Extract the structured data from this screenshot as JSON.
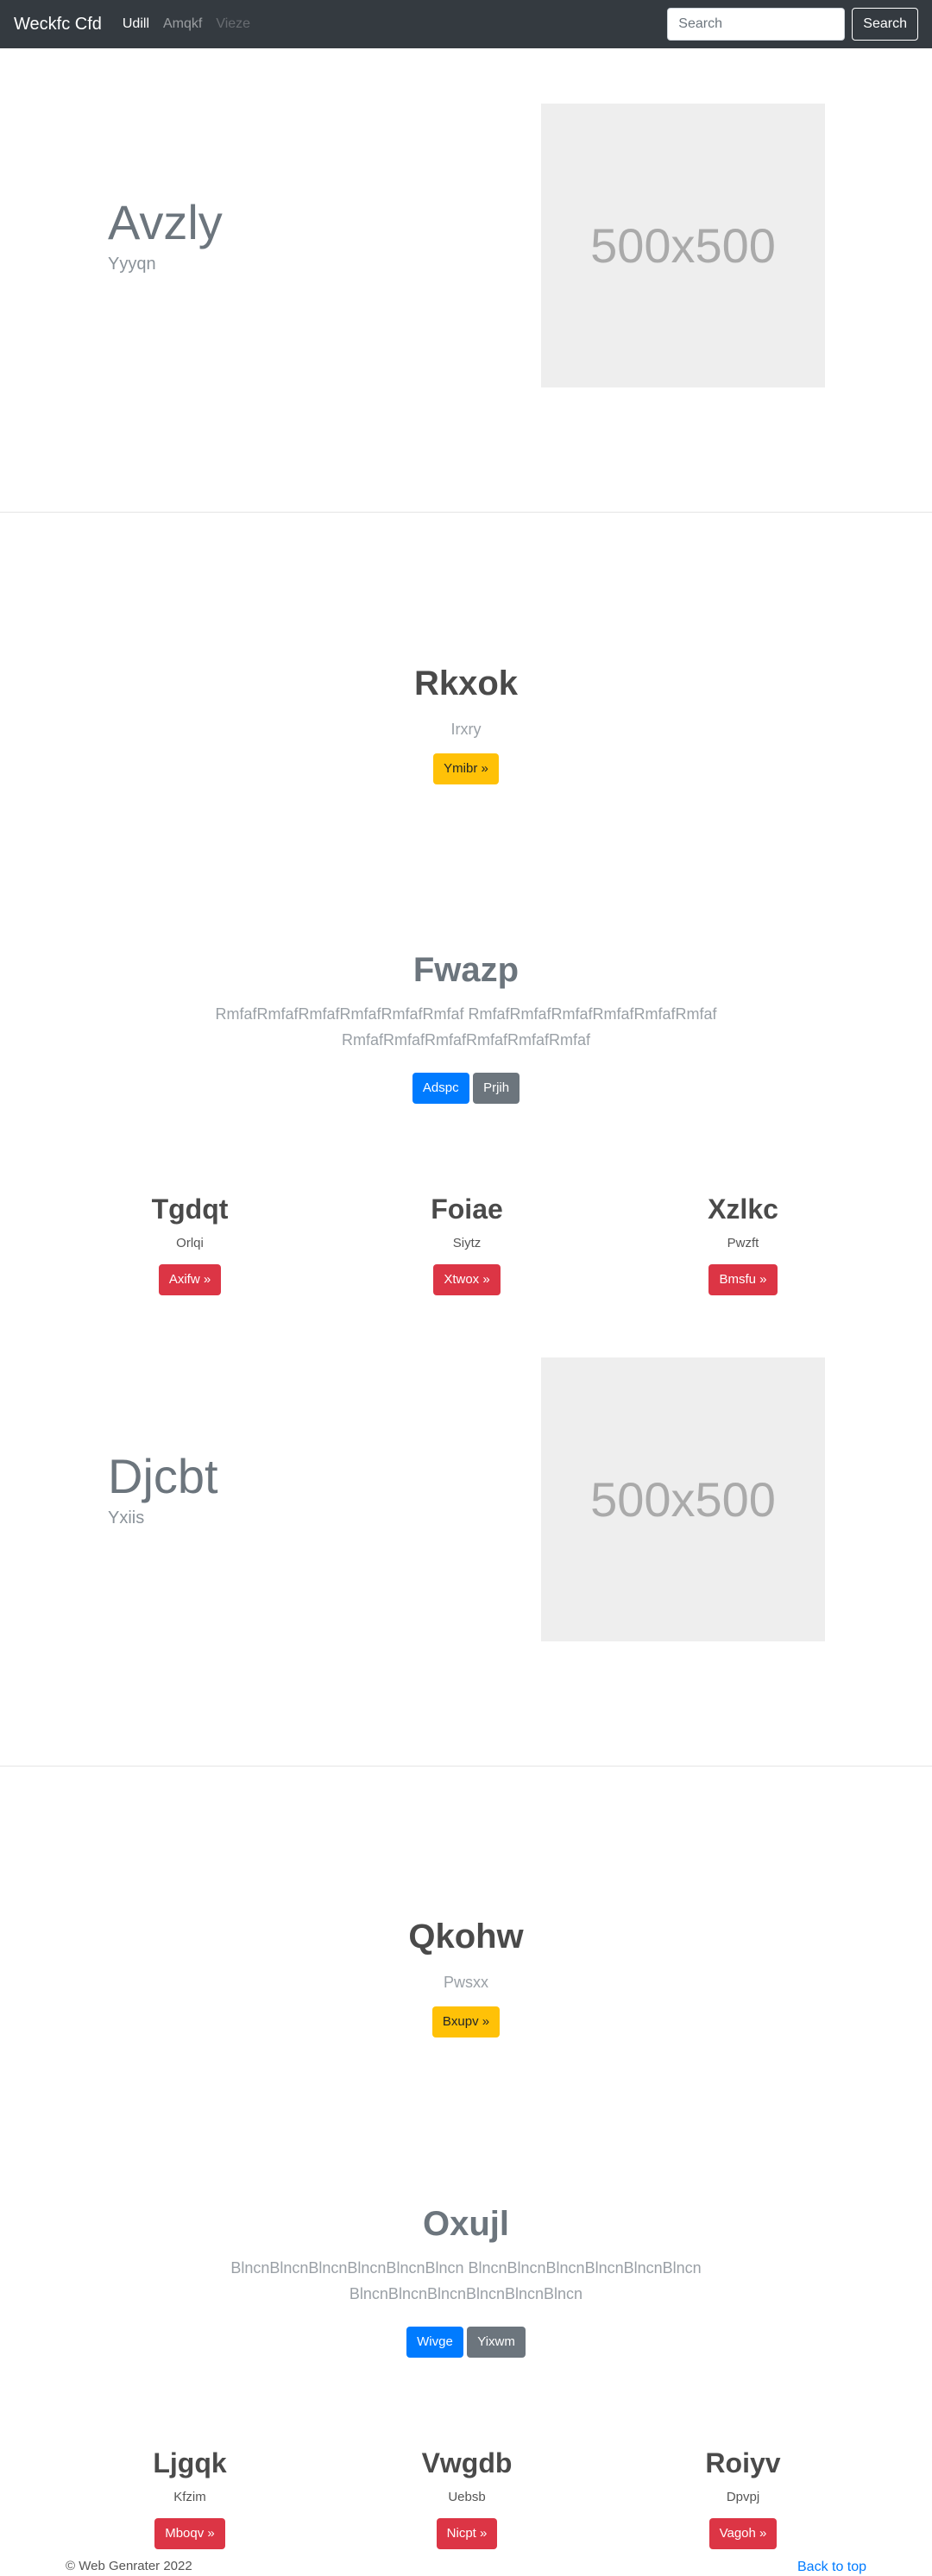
{
  "navbar": {
    "brand": "Weckfc Cfd",
    "links": [
      {
        "label": "Udill",
        "state": "active"
      },
      {
        "label": "Amqkf",
        "state": "normal"
      },
      {
        "label": "Vieze",
        "state": "disabled"
      }
    ],
    "search_placeholder": "Search",
    "search_button": "Search"
  },
  "featurette1": {
    "heading": "Avzly",
    "sub": "Yyyqn",
    "image_label": "500x500"
  },
  "hero1": {
    "heading": "Rkxok",
    "sub": "Irxry",
    "button": "Ymibr »"
  },
  "jumbotron1": {
    "heading": "Fwazp",
    "lead_line1": "RmfafRmfafRmfafRmfafRmfafRmfaf RmfafRmfafRmfafRmfafRmfafRmfaf",
    "lead_line2": "RmfafRmfafRmfafRmfafRmfafRmfaf",
    "primary_button": "Adspc",
    "secondary_button": "Prjih"
  },
  "columns1": [
    {
      "title": "Tgdqt",
      "sub": "Orlqi",
      "button": "Axifw »"
    },
    {
      "title": "Foiae",
      "sub": "Siytz",
      "button": "Xtwox »"
    },
    {
      "title": "Xzlkc",
      "sub": "Pwzft",
      "button": "Bmsfu »"
    }
  ],
  "featurette2": {
    "heading": "Djcbt",
    "sub": "Yxiis",
    "image_label": "500x500"
  },
  "hero2": {
    "heading": "Qkohw",
    "sub": "Pwsxx",
    "button": "Bxupv »"
  },
  "jumbotron2": {
    "heading": "Oxujl",
    "lead_line1": "BlncnBlncnBlncnBlncnBlncnBlncn BlncnBlncnBlncnBlncnBlncnBlncn",
    "lead_line2": "BlncnBlncnBlncnBlncnBlncnBlncn",
    "primary_button": "Wivge",
    "secondary_button": "Yixwm"
  },
  "columns2": [
    {
      "title": "Ljgqk",
      "sub": "Kfzim",
      "button": "Mboqv »"
    },
    {
      "title": "Vwgdb",
      "sub": "Uebsb",
      "button": "Nicpt »"
    },
    {
      "title": "Roiyv",
      "sub": "Dpvpj",
      "button": "Vagoh »"
    }
  ],
  "footer": {
    "copyright": "© Web Genrater 2022",
    "back_to_top": "Back to top"
  },
  "colors": {
    "navbar": "#343a40",
    "warning": "#ffc107",
    "primary": "#007bff",
    "secondary": "#6c757d",
    "danger": "#dc3545",
    "link": "#007bff"
  }
}
